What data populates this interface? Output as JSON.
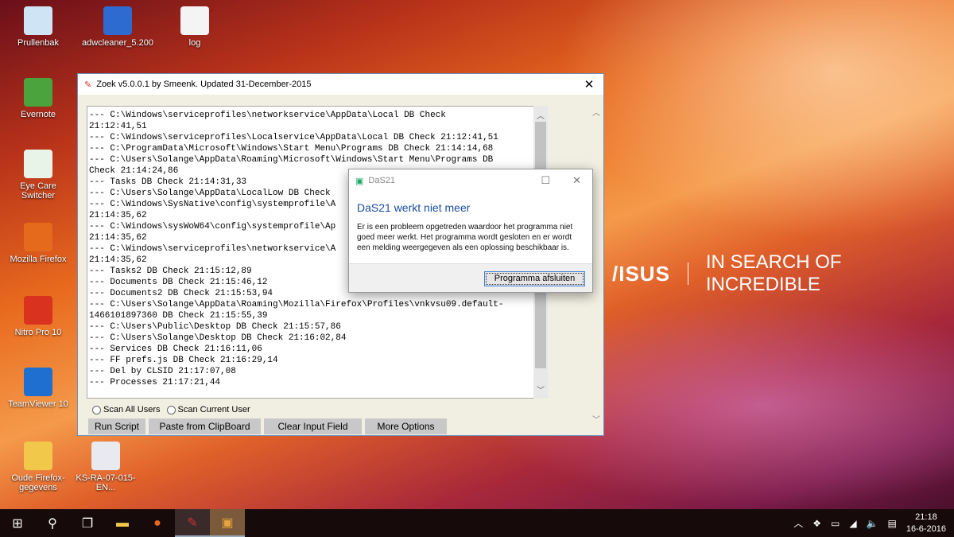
{
  "desktop": {
    "icons": [
      {
        "label": "Prullenbak",
        "icon": "recycle-bin-icon",
        "color": "#cfe4f5"
      },
      {
        "label": "adwcleaner_5.200",
        "icon": "adwcleaner-icon",
        "color": "#2d6bd1"
      },
      {
        "label": "log",
        "icon": "text-file-icon",
        "color": "#f4f4f4"
      },
      {
        "label": "Evernote",
        "icon": "evernote-icon",
        "color": "#4aa33c"
      },
      {
        "label": "Eye Care Switcher",
        "icon": "eye-icon",
        "color": "#e8f4e8"
      },
      {
        "label": "Mozilla Firefox",
        "icon": "firefox-icon",
        "color": "#e66a1c"
      },
      {
        "label": "Nitro Pro 10",
        "icon": "nitro-icon",
        "color": "#d9321e"
      },
      {
        "label": "TeamViewer 10",
        "icon": "teamviewer-icon",
        "color": "#1f6fd0"
      },
      {
        "label": "Oude Firefox-gegevens",
        "icon": "folder-icon",
        "color": "#f2c84b"
      },
      {
        "label": "KS-RA-07-015-EN...",
        "icon": "pdf-file-icon",
        "color": "#e9e9f0"
      }
    ]
  },
  "brand": {
    "logo": "/ISUS",
    "tagline": "IN SEARCH OF INCREDIBLE"
  },
  "zoek": {
    "title": "Zoek v5.0.0.1 by Smeenk. Updated 31-December-2015",
    "log": "--- C:\\Windows\\serviceprofiles\\networkservice\\AppData\\Local DB Check\n21:12:41,51\n--- C:\\Windows\\serviceprofiles\\Localservice\\AppData\\Local DB Check 21:12:41,51\n--- C:\\ProgramData\\Microsoft\\Windows\\Start Menu\\Programs DB Check 21:14:14,68\n--- C:\\Users\\Solange\\AppData\\Roaming\\Microsoft\\Windows\\Start Menu\\Programs DB\nCheck 21:14:24,86\n--- Tasks DB Check 21:14:31,33\n--- C:\\Users\\Solange\\AppData\\LocalLow DB Check\n--- C:\\Windows\\SysNative\\config\\systemprofile\\A\n21:14:35,62\n--- C:\\Windows\\sysWoW64\\config\\systemprofile\\Ap\n21:14:35,62\n--- C:\\Windows\\serviceprofiles\\networkservice\\A\n21:14:35,62\n--- Tasks2 DB Check 21:15:12,89\n--- Documents DB Check 21:15:46,12\n--- Documents2 DB Check 21:15:53,94\n--- C:\\Users\\Solange\\AppData\\Roaming\\Mozilla\\Firefox\\Profiles\\vnkvsu09.default-\n1466101897360 DB Check 21:15:55,39\n--- C:\\Users\\Public\\Desktop DB Check 21:15:57,86\n--- C:\\Users\\Solange\\Desktop DB Check 21:16:02,84\n--- Services DB Check 21:16:11,06\n--- FF prefs.js DB Check 21:16:29,14\n--- Del by CLSID 21:17:07,08\n--- Processes 21:17:21,44",
    "radio_all": "Scan All Users",
    "radio_current": "Scan Current User",
    "buttons": [
      "Run Script",
      "Paste from ClipBoard",
      "Clear Input Field",
      "More Options"
    ]
  },
  "dialog": {
    "title": "DaS21",
    "heading": "DaS21 werkt niet meer",
    "message": "Er is een probleem opgetreden waardoor het programma niet goed meer werkt. Het programma wordt gesloten en er wordt een melding weergegeven als een oplossing beschikbaar is.",
    "button": "Programma afsluiten"
  },
  "taskbar": {
    "time": "21:18",
    "date": "16-6-2016"
  }
}
